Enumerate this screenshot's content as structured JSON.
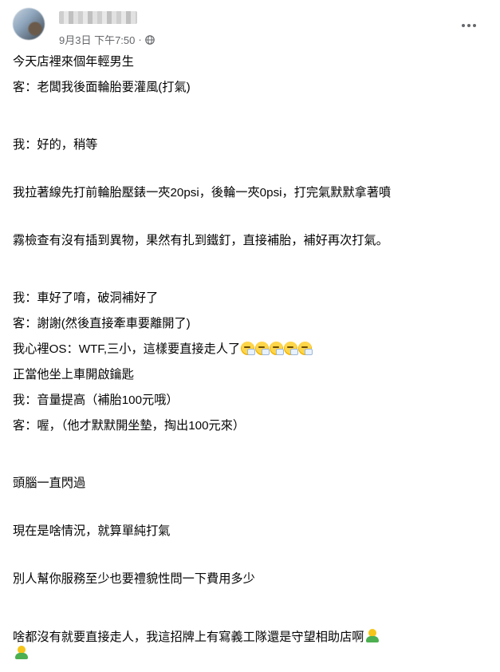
{
  "post": {
    "timestamp": "9月3日 下午7:50",
    "separator": "·",
    "more_icon": "more-horizontal-icon",
    "privacy_icon": "globe-icon"
  },
  "content": {
    "p1": "今天店裡來個年輕男生",
    "p2": "客：老闆我後面輪胎要灌風(打氣)",
    "p3_l1": "我：好的，稍等",
    "p3_l2": "我拉著線先打前輪胎壓錶一夾20psi，後輪一夾0psi，打完氣默默拿著噴",
    "p3_l3": "霧檢查有沒有插到異物，果然有扎到鐵釘，直接補胎，補好再次打氣。",
    "p4": "我：車好了唷，破洞補好了",
    "p5": "客：謝謝(然後直接牽車要離開了)",
    "p6": "我心裡OS：WTF,三小，這樣要直接走人了",
    "p7": "正當他坐上車開啟鑰匙",
    "p8": "我：音量提高（補胎100元哦）",
    "p9": "客：喔，（他才默默開坐墊，掏出100元來）",
    "p10_l1": "頭腦一直閃過",
    "p10_l2": "現在是啥情況，就算單純打氣",
    "p10_l3": "別人幫你服務至少也要禮貌性問一下費用多少",
    "p11": "啥都沒有就要直接走人，我這招牌上有寫義工隊還是守望相助店啊"
  }
}
